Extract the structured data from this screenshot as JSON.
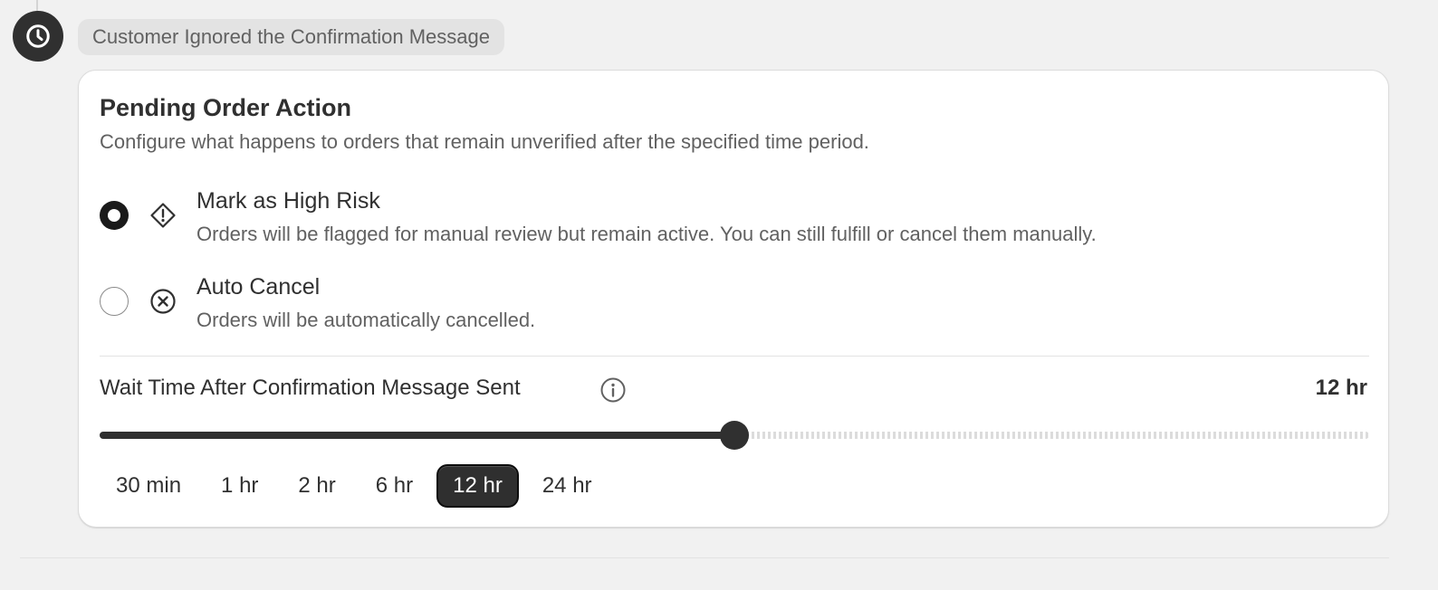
{
  "timeline": {
    "event_label": "Customer Ignored the Confirmation Message",
    "node_icon": "clock-icon"
  },
  "card": {
    "title": "Pending Order Action",
    "description": "Configure what happens to orders that remain unverified after the specified time period."
  },
  "options": [
    {
      "label": "Mark as High Risk",
      "description": "Orders will be flagged for manual review but remain active. You can still fulfill or cancel them manually.",
      "icon": "alert-diamond-icon",
      "selected": true
    },
    {
      "label": "Auto Cancel",
      "description": "Orders will be automatically cancelled.",
      "icon": "x-circle-icon",
      "selected": false
    }
  ],
  "wait_time": {
    "label": "Wait Time After Confirmation Message Sent",
    "info_icon": "info-icon",
    "value_display": "12 hr",
    "selected_index": 4,
    "slider_fraction": 0.5,
    "presets": [
      "30 min",
      "1 hr",
      "2 hr",
      "6 hr",
      "12 hr",
      "24 hr"
    ]
  },
  "colors": {
    "page_background": "#f1f1f1",
    "card_background": "#ffffff",
    "primary_text": "#303030",
    "secondary_text": "#616161",
    "accent_dark": "#303030"
  }
}
